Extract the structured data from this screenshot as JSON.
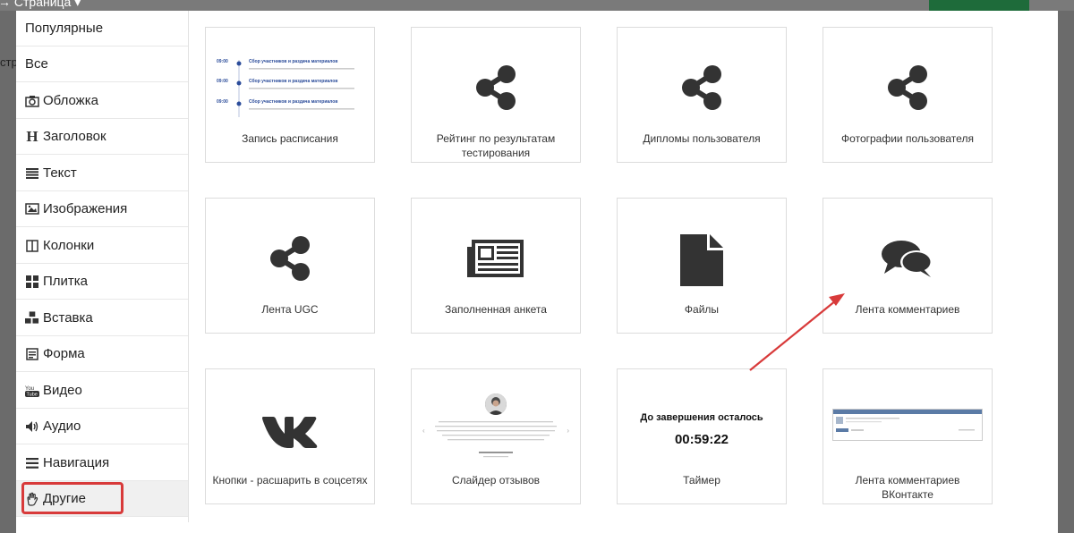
{
  "background": {
    "page_label": "→ Страница ▾",
    "left_fragment": "стр"
  },
  "sidebar": {
    "items": [
      {
        "label": "Популярные",
        "icon": null
      },
      {
        "label": "Все",
        "icon": null
      },
      {
        "label": "Обложка",
        "icon": "camera-icon"
      },
      {
        "label": "Заголовок",
        "icon": "header-icon"
      },
      {
        "label": "Текст",
        "icon": "text-lines-icon"
      },
      {
        "label": "Изображения",
        "icon": "image-icon"
      },
      {
        "label": "Колонки",
        "icon": "columns-icon"
      },
      {
        "label": "Плитка",
        "icon": "tiles-icon"
      },
      {
        "label": "Вставка",
        "icon": "cubes-icon"
      },
      {
        "label": "Форма",
        "icon": "form-icon"
      },
      {
        "label": "Видео",
        "icon": "youtube-icon"
      },
      {
        "label": "Аудио",
        "icon": "speaker-icon"
      },
      {
        "label": "Навигация",
        "icon": "menu-icon"
      },
      {
        "label": "Другие",
        "icon": "hand-icon",
        "active": true
      }
    ]
  },
  "cards": [
    {
      "label": "Запись расписания",
      "preview": "schedule"
    },
    {
      "label": "Рейтинг по результатам тестирования",
      "preview": "share-icon"
    },
    {
      "label": "Дипломы пользователя",
      "preview": "share-icon"
    },
    {
      "label": "Фотографии пользователя",
      "preview": "share-icon"
    },
    {
      "label": "Лента UGC",
      "preview": "share-icon"
    },
    {
      "label": "Заполненная анкета",
      "preview": "newspaper-icon"
    },
    {
      "label": "Файлы",
      "preview": "file-icon"
    },
    {
      "label": "Лента комментариев",
      "preview": "comments-icon"
    },
    {
      "label": "Кнопки - расшарить в соцсетях",
      "preview": "vk-icon"
    },
    {
      "label": "Слайдер отзывов",
      "preview": "reviews"
    },
    {
      "label": "Таймер",
      "preview": "timer"
    },
    {
      "label": "Лента комментариев ВКонтакте",
      "preview": "vk-comments"
    }
  ],
  "schedule_preview": {
    "rows": [
      {
        "time": "09:00",
        "title": "Сбор участников и раздача материалов"
      },
      {
        "time": "09:00",
        "title": "Сбор участников и раздача материалов"
      },
      {
        "time": "09:00",
        "title": "Сбор участников и раздача материалов"
      }
    ]
  },
  "timer_preview": {
    "title": "До завершения осталось",
    "value": "00:59:22"
  },
  "colors": {
    "highlight": "#d83a3a",
    "icon": "#333333",
    "schedule_accent": "#2b4c9a"
  }
}
